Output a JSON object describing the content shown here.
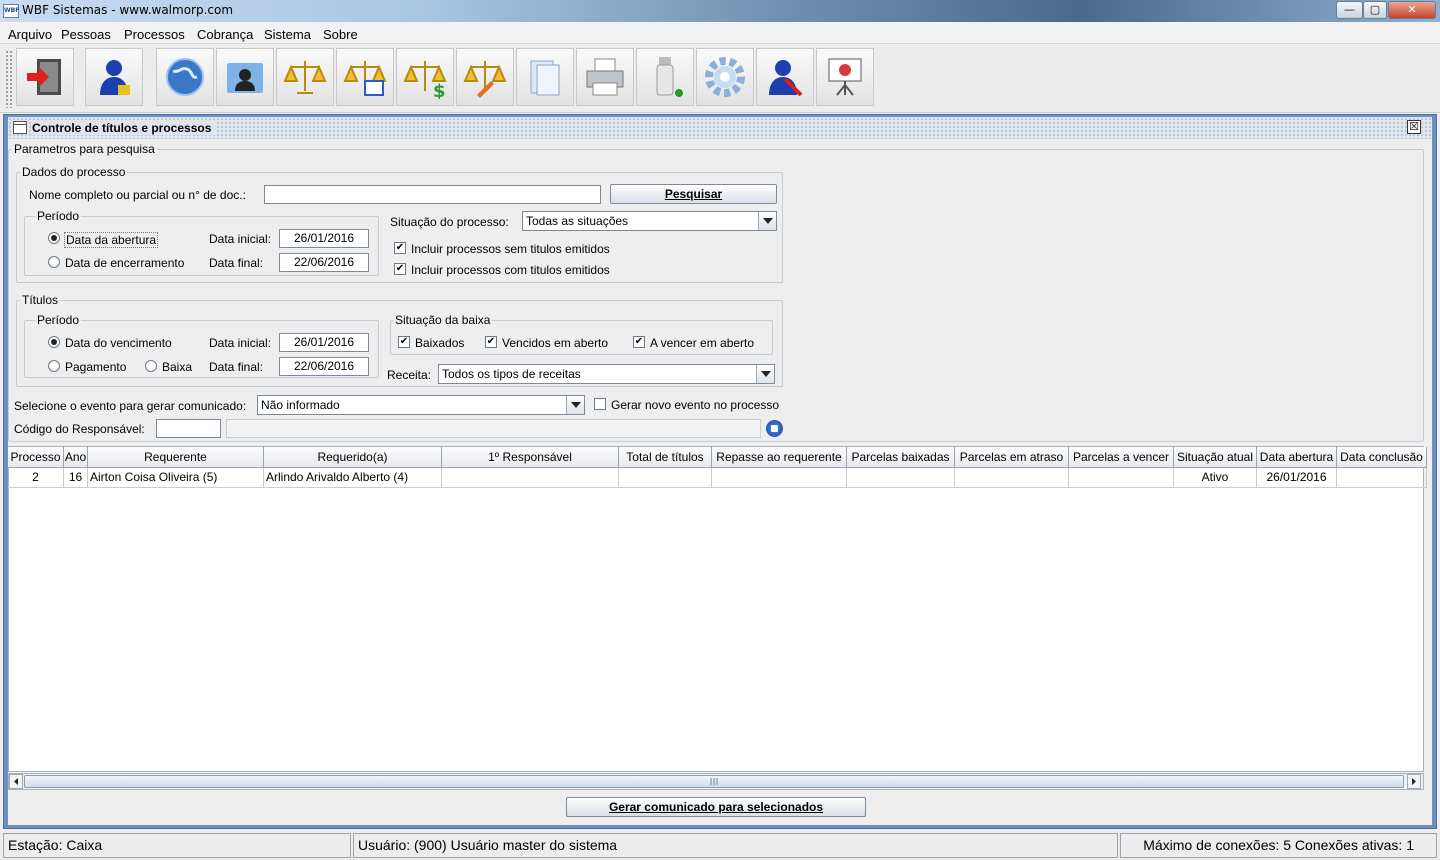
{
  "window": {
    "title": "WBF Sistemas - www.walmorp.com",
    "minimize": "—",
    "maximize": "▢",
    "close": "✕"
  },
  "menu": [
    "Arquivo",
    "Pessoas",
    "Processos",
    "Cobrança",
    "Sistema",
    "Sobre"
  ],
  "toolbar": [
    "exit-icon",
    "user-icon",
    "globe-icon",
    "contacts-folder-icon",
    "scales-icon",
    "scales-window-icon",
    "scales-money-icon",
    "scales-edit-icon",
    "documents-icon",
    "printer-icon",
    "usb-drive-icon",
    "settings-gear-icon",
    "user-edit-icon",
    "presentation-icon"
  ],
  "internal_frame": {
    "title": "Controle de títulos e processos",
    "close": "☒"
  },
  "search": {
    "group_label": "Parametros para pesquisa",
    "process_group": "Dados do processo",
    "name_label": "Nome completo ou parcial ou n° de doc.:",
    "name_value": "",
    "search_button": "Pesquisar",
    "period_label": "Período",
    "opening_date_radio": "Data da abertura",
    "closing_date_radio": "Data de encerramento",
    "start_label": "Data inicial:",
    "end_label": "Data final:",
    "start_value": "26/01/2016",
    "end_value": "22/06/2016",
    "status_label": "Situação do processo:",
    "status_value": "Todas as situações",
    "chk_without_titles": "Incluir processos sem titulos emitidos",
    "chk_with_titles": "Incluir processos com titulos emitidos"
  },
  "titles": {
    "group_label": "Títulos",
    "period_label": "Período",
    "due_date_radio": "Data do vencimento",
    "payment_radio": "Pagamento",
    "write_off_radio": "Baixa",
    "start_label": "Data inicial:",
    "end_label": "Data final:",
    "start_value": "26/01/2016",
    "end_value": "22/06/2016",
    "write_off_group": "Situação da baixa",
    "chk_written_off": "Baixados",
    "chk_overdue": "Vencidos em aberto",
    "chk_to_expire": "A vencer em aberto",
    "revenue_label": "Receita:",
    "revenue_value": "Todos os tipos de receitas"
  },
  "event": {
    "label": "Selecione o evento para gerar comunicado:",
    "value": "Não informado",
    "chk_new_event": "Gerar novo evento no processo",
    "responsible_label": "Código do Responsável:",
    "responsible_code": "",
    "responsible_name": ""
  },
  "table": {
    "columns": [
      "Processo",
      "Ano",
      "Requerente",
      "Requerido(a)",
      "1º Responsável",
      "Total de títulos",
      "Repasse ao requerente",
      "Parcelas baixadas",
      "Parcelas em atraso",
      "Parcelas a vencer",
      "Situação atual",
      "Data abertura",
      "Data conclusão"
    ],
    "rows": [
      [
        "2",
        "16",
        "Airton Coisa Oliveira (5)",
        "Arlindo Arivaldo Alberto (4)",
        "",
        "",
        "",
        "",
        "",
        "",
        "Ativo",
        "26/01/2016",
        ""
      ]
    ]
  },
  "generate_button": "Gerar comunicado para selecionados",
  "status": {
    "station": "Estação: Caixa",
    "user": "Usuário: (900) Usuário master do sistema",
    "connections": "Máximo de conexões: 5 Conexões ativas: 1"
  }
}
